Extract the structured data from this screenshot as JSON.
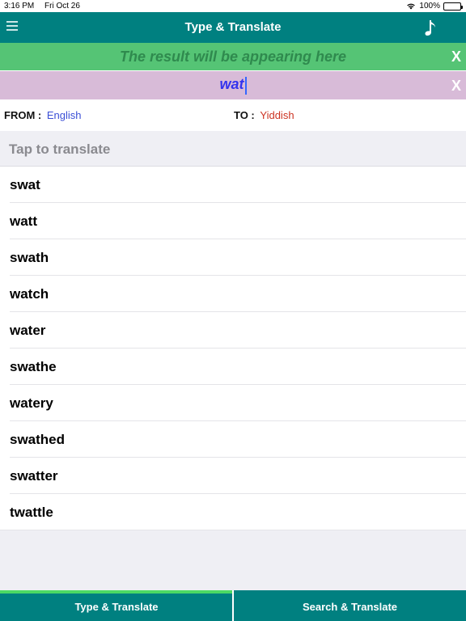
{
  "status": {
    "time": "3:16 PM",
    "date": "Fri Oct 26",
    "battery": "100%"
  },
  "nav": {
    "title": "Type & Translate",
    "menu_icon": "hamburger-menu-icon",
    "music_icon": "music-note-icon"
  },
  "result": {
    "placeholder": "The result will be appearing here",
    "clear_label": "X"
  },
  "input": {
    "value": "wat",
    "clear_label": "X"
  },
  "languages": {
    "from_label": "FROM :",
    "from_value": "English",
    "to_label": "TO :",
    "to_value": "Yiddish"
  },
  "suggestions": {
    "header": "Tap to translate",
    "items": [
      "swat",
      "watt",
      "swath",
      "watch",
      "water",
      "swathe",
      "watery",
      "swathed",
      "swatter",
      "twattle"
    ]
  },
  "tabs": {
    "type_translate": "Type & Translate",
    "search_translate": "Search & Translate"
  },
  "colors": {
    "primary": "#008080",
    "result_bar": "#55c475",
    "input_bar": "#d8bbd8",
    "active_tab_indicator": "#4cd964",
    "from_lang": "#3b4fd6",
    "to_lang": "#cc3322"
  }
}
